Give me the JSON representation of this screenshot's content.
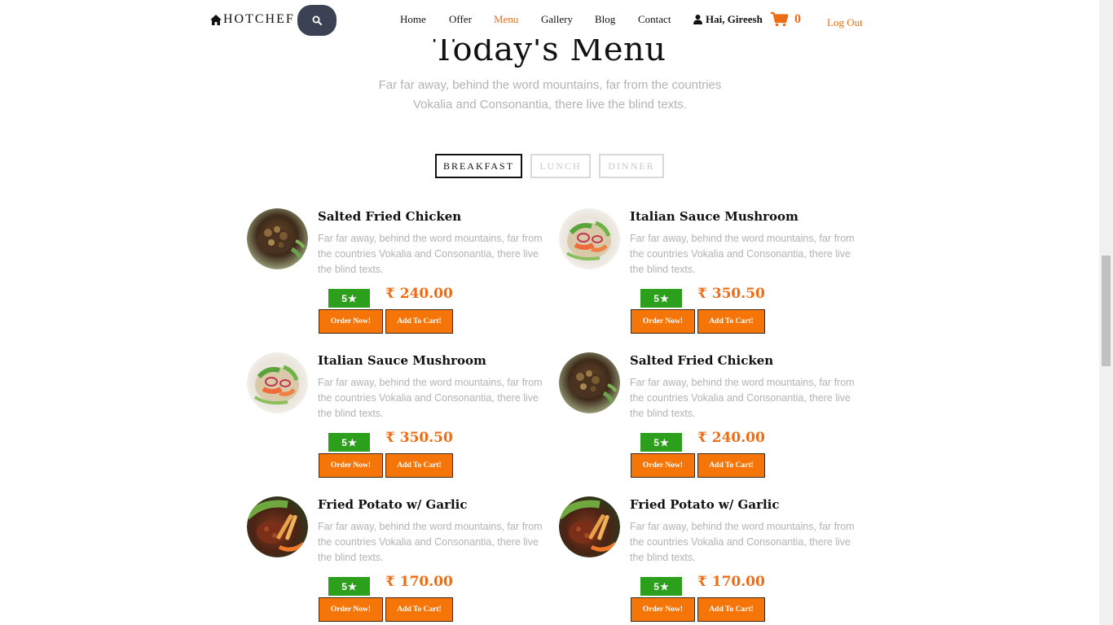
{
  "nav": {
    "brand": "HOTCHEF",
    "links": [
      {
        "label": "Home"
      },
      {
        "label": "Offer"
      },
      {
        "label": "Menu",
        "active": true
      },
      {
        "label": "Gallery"
      },
      {
        "label": "Blog"
      },
      {
        "label": "Contact"
      }
    ],
    "user_greeting": "Hai, Gireesh",
    "cart_count": "0",
    "logout": "Log Out"
  },
  "section": {
    "title": "Today's Menu",
    "subtitle": "Far far away, behind the word mountains, far from the countries Vokalia and Consonantia, there live the blind texts."
  },
  "tabs": [
    {
      "label": "BREAKFAST",
      "active": true
    },
    {
      "label": "LUNCH",
      "active": false
    },
    {
      "label": "DINNER",
      "active": false
    }
  ],
  "items": [
    {
      "name": "Salted Fried Chicken",
      "description": "Far far away, behind the word mountains, far from the countries Vokalia and Consonantia, there live the blind texts.",
      "rating": "5",
      "price": "₹ 240.00",
      "order_label": "Order Now!",
      "cart_label": "Add To Cart!",
      "image": "chicken"
    },
    {
      "name": "Italian Sauce Mushroom",
      "description": "Far far away, behind the word mountains, far from the countries Vokalia and Consonantia, there live the blind texts.",
      "rating": "5",
      "price": "₹ 350.50",
      "order_label": "Order Now!",
      "cart_label": "Add To Cart!",
      "image": "salad"
    },
    {
      "name": "Italian Sauce Mushroom",
      "description": "Far far away, behind the word mountains, far from the countries Vokalia and Consonantia, there live the blind texts.",
      "rating": "5",
      "price": "₹ 350.50",
      "order_label": "Order Now!",
      "cart_label": "Add To Cart!",
      "image": "salad"
    },
    {
      "name": "Salted Fried Chicken",
      "description": "Far far away, behind the word mountains, far from the countries Vokalia and Consonantia, there live the blind texts.",
      "rating": "5",
      "price": "₹ 240.00",
      "order_label": "Order Now!",
      "cart_label": "Add To Cart!",
      "image": "chicken"
    },
    {
      "name": "Fried Potato w/ Garlic",
      "description": "Far far away, behind the word mountains, far from the countries Vokalia and Consonantia, there live the blind texts.",
      "rating": "5",
      "price": "₹ 170.00",
      "order_label": "Order Now!",
      "cart_label": "Add To Cart!",
      "image": "potato"
    },
    {
      "name": "Fried Potato w/ Garlic",
      "description": "Far far away, behind the word mountains, far from the countries Vokalia and Consonantia, there live the blind texts.",
      "rating": "5",
      "price": "₹ 170.00",
      "order_label": "Order Now!",
      "cart_label": "Add To Cart!",
      "image": "potato"
    }
  ],
  "colors": {
    "accent": "#ee6c15",
    "button": "#f57508",
    "rating": "#2ca01c",
    "search_button": "#3a4253",
    "muted_text": "#b3b3b3"
  },
  "icons": {
    "brand": "home-icon",
    "search": "search-icon",
    "user": "user-icon",
    "cart": "cart-icon",
    "rating": "star-icon"
  }
}
